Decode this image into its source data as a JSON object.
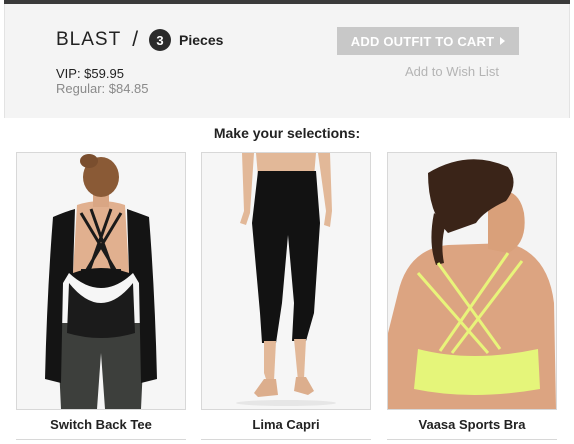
{
  "outfit": {
    "name": "BLAST",
    "separator": "/",
    "piece_count": "3",
    "pieces_label": "Pieces",
    "vip_price": "VIP: $59.95",
    "regular_price": "Regular: $84.85"
  },
  "actions": {
    "add_to_cart": "ADD OUTFIT TO CART",
    "wish_list": "Add to Wish List"
  },
  "selections_heading": "Make your selections:",
  "products": [
    {
      "name": "Switch Back Tee"
    },
    {
      "name": "Lima Capri"
    },
    {
      "name": "Vaasa Sports Bra"
    }
  ],
  "colors": {
    "button_disabled": "#c8c8c8",
    "header_bg": "#f4f4f4",
    "bra_color": "#e5f57a"
  }
}
